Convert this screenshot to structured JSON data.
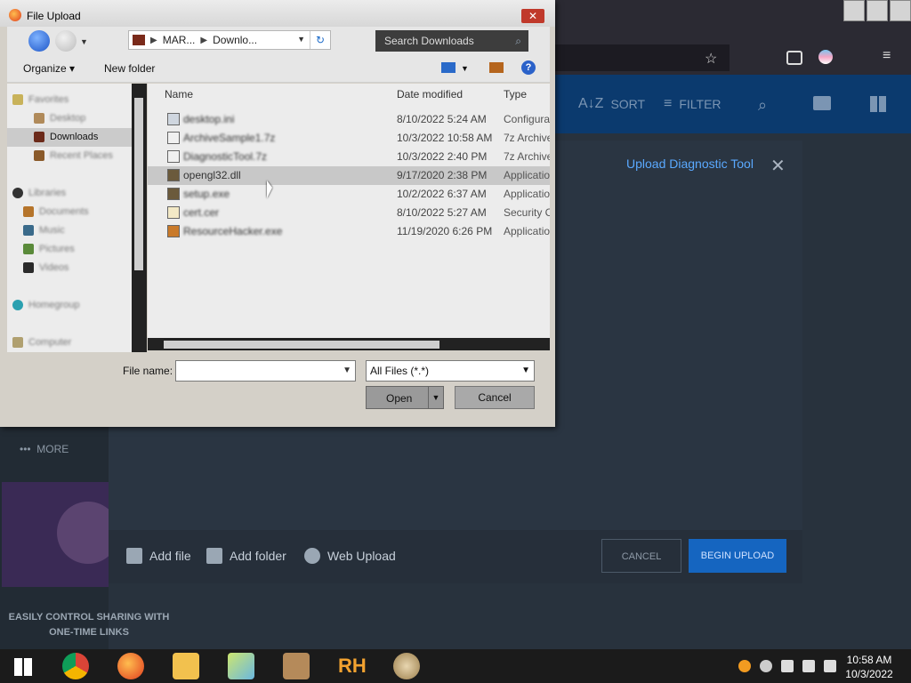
{
  "dialog": {
    "title": "File Upload",
    "address": [
      "MAR...",
      "Downlo..."
    ],
    "search_placeholder": "Search Downloads",
    "commands": {
      "organize": "Organize",
      "new_folder": "New folder"
    },
    "tree": {
      "selected": "Downloads",
      "blurred_items": [
        "Favorites",
        "Desktop",
        "Recent Places",
        "Libraries",
        "Documents",
        "Music",
        "Pictures",
        "Videos",
        "Homegroup",
        "Computer"
      ]
    },
    "columns": {
      "name": "Name",
      "date": "Date modified",
      "type": "Type"
    },
    "files": [
      {
        "name": "desktop.ini",
        "date": "8/10/2022 5:24 AM",
        "type": "Configura",
        "blur": true,
        "selected": false,
        "icon_color": "#cfd6df"
      },
      {
        "name": "ArchiveSample1.7z",
        "date": "10/3/2022 10:58 AM",
        "type": "7z Archive",
        "blur": true,
        "selected": false,
        "icon_color": "#f0f0f0"
      },
      {
        "name": "DiagnosticTool.7z",
        "date": "10/3/2022 2:40 PM",
        "type": "7z Archive",
        "blur": true,
        "selected": false,
        "icon_color": "#f0f0f0"
      },
      {
        "name": "opengl32.dll",
        "date": "9/17/2020 2:38 PM",
        "type": "Applicatio",
        "blur": false,
        "selected": true,
        "icon_color": "#6b5a3c"
      },
      {
        "name": "setup.exe",
        "date": "10/2/2022 6:37 AM",
        "type": "Applicatio",
        "blur": true,
        "selected": false,
        "icon_color": "#6b5a3c"
      },
      {
        "name": "cert.cer",
        "date": "8/10/2022 5:27 AM",
        "type": "Security C",
        "blur": true,
        "selected": false,
        "icon_color": "#f3e9c6"
      },
      {
        "name": "ResourceHacker.exe",
        "date": "11/19/2020 6:26 PM",
        "type": "Applicatio",
        "blur": true,
        "selected": false,
        "icon_color": "#c97a2a"
      }
    ],
    "file_name_label": "File name:",
    "file_name_value": "",
    "filter": "All Files (*.*)",
    "open_label": "Open",
    "cancel_label": "Cancel"
  },
  "app": {
    "tools": {
      "sort": "SORT",
      "filter": "FILTER"
    },
    "modal_title": "Upload Diagnostic Tool",
    "footer": {
      "add_file": "Add file",
      "add_folder": "Add folder",
      "web_upload": "Web Upload",
      "cancel": "CANCEL",
      "begin": "BEGIN UPLOAD"
    },
    "more": "MORE",
    "promo": [
      "EASILY CONTROL SHARING WITH",
      "ONE-TIME LINKS"
    ]
  },
  "taskbar": {
    "time": "10:58 AM",
    "date": "10/3/2022"
  }
}
